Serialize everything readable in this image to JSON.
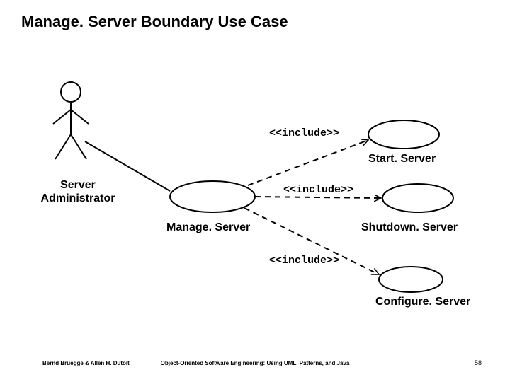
{
  "title": "Manage. Server Boundary Use Case",
  "actor": {
    "name": "Server\nAdministrator"
  },
  "usecases": {
    "manage": "Manage. Server",
    "start": "Start. Server",
    "shutdown": "Shutdown. Server",
    "configure": "Configure. Server"
  },
  "relations": {
    "include1": "<<include>>",
    "include2": "<<include>>",
    "include3": "<<include>>"
  },
  "footer": {
    "left": "Bernd Bruegge & Allen H. Dutoit",
    "center": "Object-Oriented Software Engineering: Using UML, Patterns, and Java",
    "page": "58"
  },
  "chart_data": {
    "type": "uml-use-case",
    "actors": [
      "Server Administrator"
    ],
    "usecases": [
      "Manage.Server",
      "Start.Server",
      "Shutdown.Server",
      "Configure.Server"
    ],
    "associations": [
      {
        "from": "Server Administrator",
        "to": "Manage.Server",
        "type": "association"
      },
      {
        "from": "Manage.Server",
        "to": "Start.Server",
        "type": "include"
      },
      {
        "from": "Manage.Server",
        "to": "Shutdown.Server",
        "type": "include"
      },
      {
        "from": "Manage.Server",
        "to": "Configure.Server",
        "type": "include"
      }
    ]
  }
}
